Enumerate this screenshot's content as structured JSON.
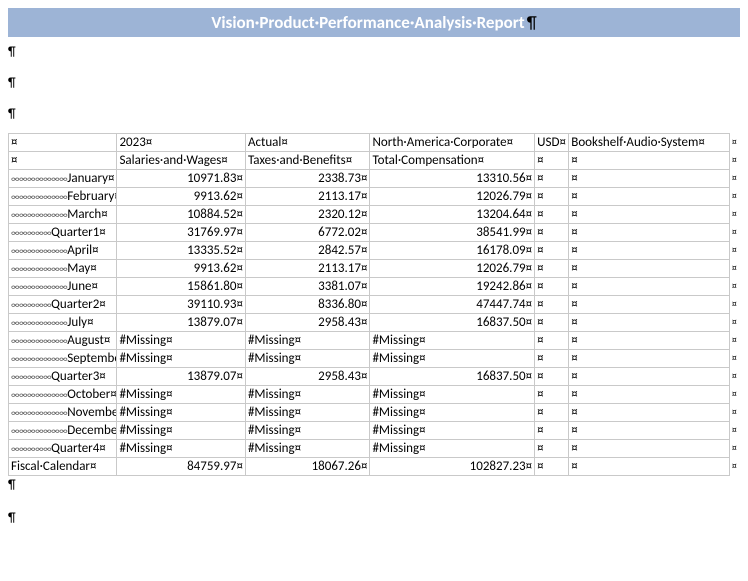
{
  "title": "Vision·Product·Performance·Analysis·Report",
  "pilcrow": "¶",
  "cell_end": "¤",
  "row_end": "¤",
  "indent2": "∞∞∞∞∞",
  "indent3": "∞∞∞∞∞∞∞",
  "header1": [
    "",
    "2023",
    "Actual",
    "North·America·Corporate",
    "USD",
    "Bookshelf·Audio·System"
  ],
  "header2": [
    "",
    "Salaries·and·Wages",
    "Taxes·and·Benefits",
    "Total·Compensation",
    "",
    ""
  ],
  "rows": [
    {
      "indent": 3,
      "label": "January",
      "v": [
        "10971.83",
        "2338.73",
        "13310.56",
        "",
        ""
      ]
    },
    {
      "indent": 3,
      "label": "February",
      "v": [
        "9913.62",
        "2113.17",
        "12026.79",
        "",
        ""
      ]
    },
    {
      "indent": 3,
      "label": "March",
      "v": [
        "10884.52",
        "2320.12",
        "13204.64",
        "",
        ""
      ]
    },
    {
      "indent": 2,
      "label": "Quarter1",
      "v": [
        "31769.97",
        "6772.02",
        "38541.99",
        "",
        ""
      ]
    },
    {
      "indent": 3,
      "label": "April",
      "v": [
        "13335.52",
        "2842.57",
        "16178.09",
        "",
        ""
      ]
    },
    {
      "indent": 3,
      "label": "May",
      "v": [
        "9913.62",
        "2113.17",
        "12026.79",
        "",
        ""
      ]
    },
    {
      "indent": 3,
      "label": "June",
      "v": [
        "15861.80",
        "3381.07",
        "19242.86",
        "",
        ""
      ]
    },
    {
      "indent": 2,
      "label": "Quarter2",
      "v": [
        "39110.93",
        "8336.80",
        "47447.74",
        "",
        ""
      ]
    },
    {
      "indent": 3,
      "label": "July",
      "v": [
        "13879.07",
        "2958.43",
        "16837.50",
        "",
        ""
      ]
    },
    {
      "indent": 3,
      "label": "August",
      "v": [
        "#Missing",
        "#Missing",
        "#Missing",
        "",
        ""
      ]
    },
    {
      "indent": 3,
      "label": "September",
      "v": [
        "#Missing",
        "#Missing",
        "#Missing",
        "",
        ""
      ]
    },
    {
      "indent": 2,
      "label": "Quarter3",
      "v": [
        "13879.07",
        "2958.43",
        "16837.50",
        "",
        ""
      ]
    },
    {
      "indent": 3,
      "label": "October",
      "v": [
        "#Missing",
        "#Missing",
        "#Missing",
        "",
        ""
      ]
    },
    {
      "indent": 3,
      "label": "November",
      "v": [
        "#Missing",
        "#Missing",
        "#Missing",
        "",
        ""
      ]
    },
    {
      "indent": 3,
      "label": "December",
      "v": [
        "#Missing",
        "#Missing",
        "#Missing",
        "",
        ""
      ]
    },
    {
      "indent": 2,
      "label": "Quarter4",
      "v": [
        "#Missing",
        "#Missing",
        "#Missing",
        "",
        ""
      ]
    },
    {
      "indent": 0,
      "label": "Fiscal·Calendar",
      "v": [
        "84759.97",
        "18067.26",
        "102827.23",
        "",
        ""
      ]
    }
  ]
}
